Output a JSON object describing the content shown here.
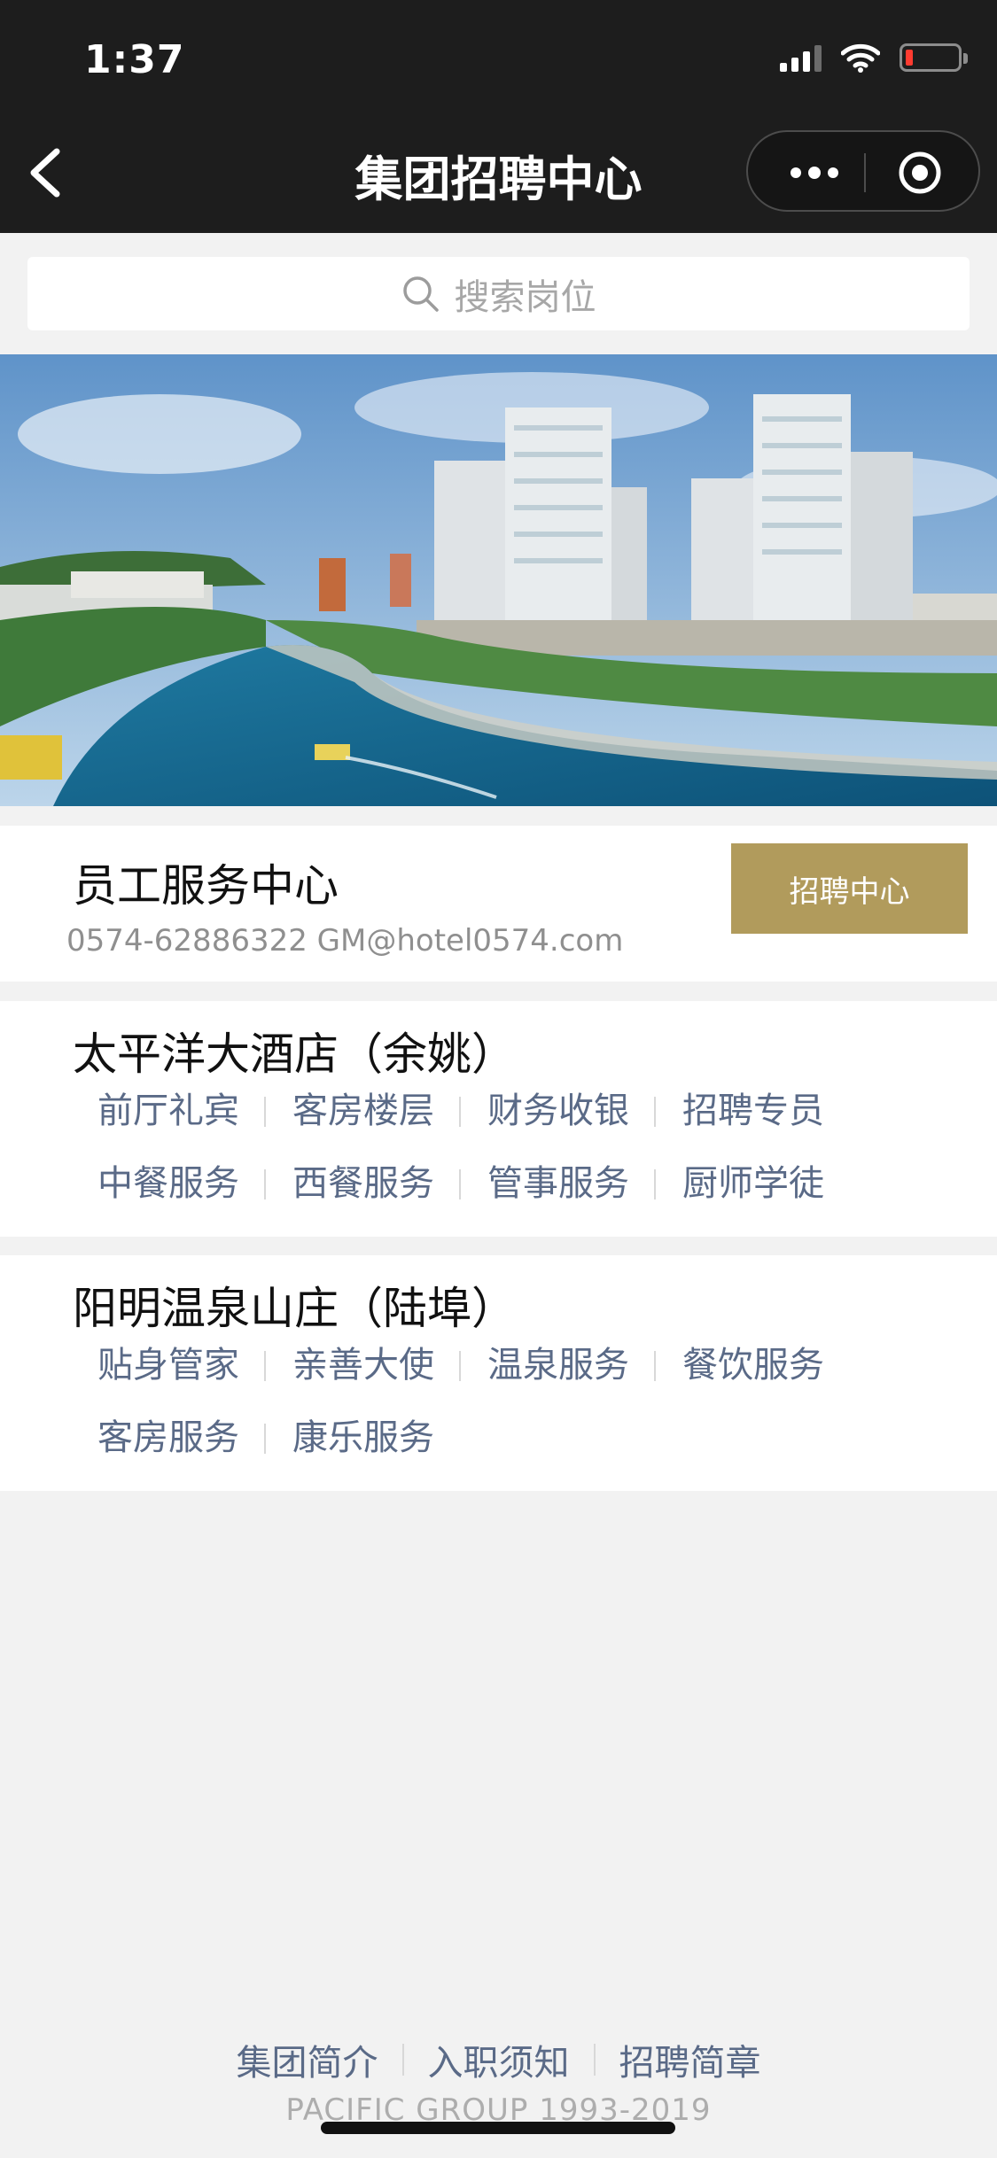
{
  "status_bar": {
    "time": "1:37"
  },
  "nav": {
    "title": "集团招聘中心"
  },
  "search": {
    "placeholder": "搜索岗位"
  },
  "banner": {
    "slide_count": 3,
    "active_slide": 1
  },
  "service_center": {
    "title": "员工服务中心",
    "contact": "0574-62886322 GM@hotel0574.com",
    "button": "招聘中心",
    "button_color": "#b19b5c"
  },
  "hotels": [
    {
      "name": "太平洋大酒店（余姚）",
      "jobs": [
        "前厅礼宾",
        "客房楼层",
        "财务收银",
        "招聘专员",
        "中餐服务",
        "西餐服务",
        "管事服务",
        "厨师学徒"
      ]
    },
    {
      "name": "阳明温泉山庄（陆埠）",
      "jobs": [
        "贴身管家",
        "亲善大使",
        "温泉服务",
        "餐饮服务",
        "客房服务",
        "康乐服务"
      ]
    }
  ],
  "footer": {
    "links": [
      "集团简介",
      "入职须知",
      "招聘简章"
    ],
    "copyright": "PACIFIC GROUP 1993-2019"
  },
  "colors": {
    "link": "#5a6a87",
    "topbar": "#1d1d1d",
    "background": "#f2f2f2"
  }
}
